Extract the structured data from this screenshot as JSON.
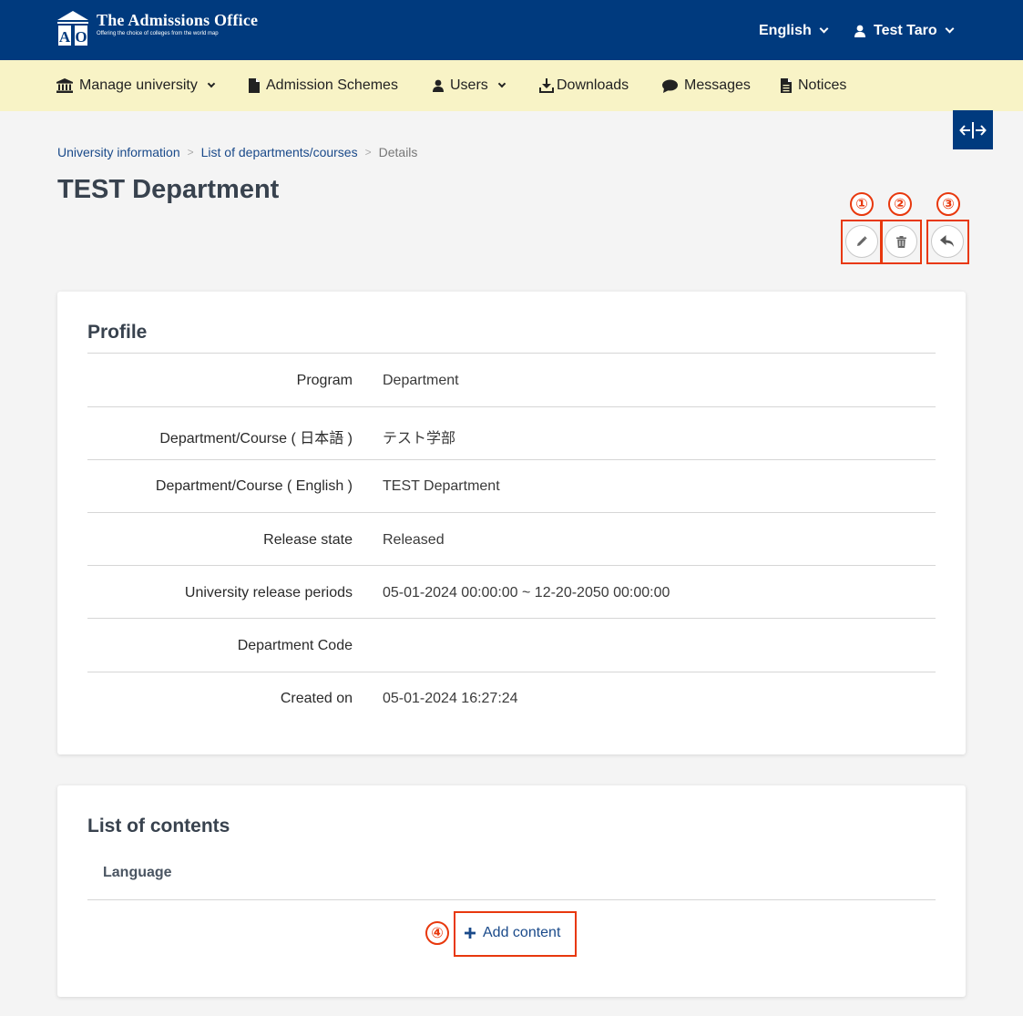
{
  "header": {
    "logo_title": "The Admissions Office",
    "logo_subtitle": "Offering the choice of colleges from the world map",
    "logo_letters": "A O",
    "language": "English",
    "user": "Test Taro"
  },
  "nav": {
    "manage_university": "Manage university",
    "admission_schemes": "Admission Schemes",
    "users": "Users",
    "downloads": "Downloads",
    "messages": "Messages",
    "notices": "Notices"
  },
  "breadcrumb": {
    "item1": "University information",
    "item2": "List of departments/courses",
    "current": "Details",
    "separator": ">"
  },
  "page_title": "TEST Department",
  "callouts": [
    "①",
    "②",
    "③",
    "④"
  ],
  "profile": {
    "title": "Profile",
    "rows": [
      {
        "label": "Program",
        "value": "Department"
      },
      {
        "label": "Department/Course ( 日本語 )",
        "value": "テスト学部"
      },
      {
        "label": "Department/Course ( English )",
        "value": "TEST Department"
      },
      {
        "label": "Release state",
        "value": "Released"
      },
      {
        "label": "University release periods",
        "value": "05-01-2024 00:00:00 ~ 12-20-2050 00:00:00"
      },
      {
        "label": "Department Code",
        "value": ""
      },
      {
        "label": "Created on",
        "value": "05-01-2024 16:27:24"
      }
    ]
  },
  "contents": {
    "title": "List of contents",
    "column_language": "Language",
    "add_content": "Add content"
  },
  "colors": {
    "primary": "#003a7e",
    "subnav": "#f8f3c6",
    "callout": "#e8380d",
    "link": "#1a4a8a"
  }
}
